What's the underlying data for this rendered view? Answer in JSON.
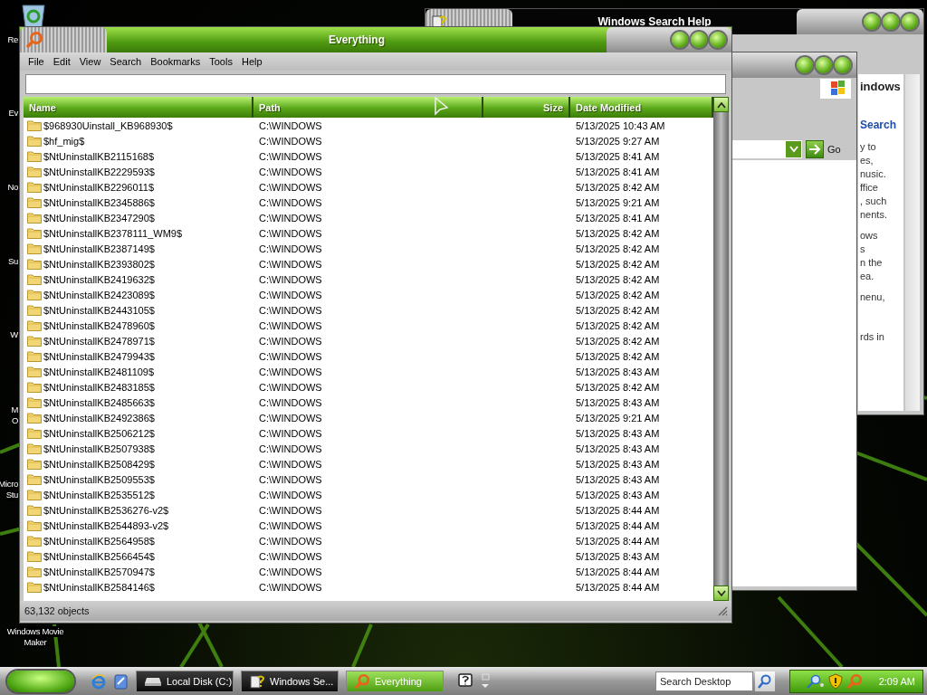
{
  "desktop_icons": [
    {
      "lines": [
        "Re"
      ]
    },
    {
      "lines": [
        "Ev"
      ]
    },
    {
      "lines": [
        "No"
      ]
    },
    {
      "lines": [
        "Su"
      ]
    },
    {
      "lines": [
        "W"
      ]
    },
    {
      "lines": [
        "M",
        "O"
      ]
    },
    {
      "lines": [
        "Micro",
        "Stu"
      ]
    },
    {
      "lines": [
        "Windows Movie",
        "Maker"
      ]
    }
  ],
  "help_window": {
    "title": "Windows Search Help",
    "heading_1": "indows",
    "heading_2": "Search",
    "paragraphs": [
      [
        "y to",
        "es,",
        "nusic.",
        "ffice",
        ", such",
        "nents."
      ],
      [
        "ows",
        "s",
        "n the",
        "ea."
      ],
      [
        "nenu,"
      ],
      [
        "rds in"
      ]
    ]
  },
  "search_window": {
    "go_label": "Go"
  },
  "everything": {
    "title": "Everything",
    "menu": [
      "File",
      "Edit",
      "View",
      "Search",
      "Bookmarks",
      "Tools",
      "Help"
    ],
    "columns": [
      {
        "label": "Name"
      },
      {
        "label": "Path"
      },
      {
        "label": "Size"
      },
      {
        "label": "Date Modified"
      }
    ],
    "rows": [
      {
        "name": "$968930Uinstall_KB968930$",
        "path": "C:\\WINDOWS",
        "modified": "5/13/2025 10:43 AM"
      },
      {
        "name": "$hf_mig$",
        "path": "C:\\WINDOWS",
        "modified": "5/13/2025 9:27 AM"
      },
      {
        "name": "$NtUninstallKB2115168$",
        "path": "C:\\WINDOWS",
        "modified": "5/13/2025 8:41 AM"
      },
      {
        "name": "$NtUninstallKB2229593$",
        "path": "C:\\WINDOWS",
        "modified": "5/13/2025 8:41 AM"
      },
      {
        "name": "$NtUninstallKB2296011$",
        "path": "C:\\WINDOWS",
        "modified": "5/13/2025 8:42 AM"
      },
      {
        "name": "$NtUninstallKB2345886$",
        "path": "C:\\WINDOWS",
        "modified": "5/13/2025 9:21 AM"
      },
      {
        "name": "$NtUninstallKB2347290$",
        "path": "C:\\WINDOWS",
        "modified": "5/13/2025 8:41 AM"
      },
      {
        "name": "$NtUninstallKB2378111_WM9$",
        "path": "C:\\WINDOWS",
        "modified": "5/13/2025 8:42 AM"
      },
      {
        "name": "$NtUninstallKB2387149$",
        "path": "C:\\WINDOWS",
        "modified": "5/13/2025 8:42 AM"
      },
      {
        "name": "$NtUninstallKB2393802$",
        "path": "C:\\WINDOWS",
        "modified": "5/13/2025 8:42 AM"
      },
      {
        "name": "$NtUninstallKB2419632$",
        "path": "C:\\WINDOWS",
        "modified": "5/13/2025 8:42 AM"
      },
      {
        "name": "$NtUninstallKB2423089$",
        "path": "C:\\WINDOWS",
        "modified": "5/13/2025 8:42 AM"
      },
      {
        "name": "$NtUninstallKB2443105$",
        "path": "C:\\WINDOWS",
        "modified": "5/13/2025 8:42 AM"
      },
      {
        "name": "$NtUninstallKB2478960$",
        "path": "C:\\WINDOWS",
        "modified": "5/13/2025 8:42 AM"
      },
      {
        "name": "$NtUninstallKB2478971$",
        "path": "C:\\WINDOWS",
        "modified": "5/13/2025 8:42 AM"
      },
      {
        "name": "$NtUninstallKB2479943$",
        "path": "C:\\WINDOWS",
        "modified": "5/13/2025 8:42 AM"
      },
      {
        "name": "$NtUninstallKB2481109$",
        "path": "C:\\WINDOWS",
        "modified": "5/13/2025 8:43 AM"
      },
      {
        "name": "$NtUninstallKB2483185$",
        "path": "C:\\WINDOWS",
        "modified": "5/13/2025 8:42 AM"
      },
      {
        "name": "$NtUninstallKB2485663$",
        "path": "C:\\WINDOWS",
        "modified": "5/13/2025 8:43 AM"
      },
      {
        "name": "$NtUninstallKB2492386$",
        "path": "C:\\WINDOWS",
        "modified": "5/13/2025 9:21 AM"
      },
      {
        "name": "$NtUninstallKB2506212$",
        "path": "C:\\WINDOWS",
        "modified": "5/13/2025 8:43 AM"
      },
      {
        "name": "$NtUninstallKB2507938$",
        "path": "C:\\WINDOWS",
        "modified": "5/13/2025 8:43 AM"
      },
      {
        "name": "$NtUninstallKB2508429$",
        "path": "C:\\WINDOWS",
        "modified": "5/13/2025 8:43 AM"
      },
      {
        "name": "$NtUninstallKB2509553$",
        "path": "C:\\WINDOWS",
        "modified": "5/13/2025 8:43 AM"
      },
      {
        "name": "$NtUninstallKB2535512$",
        "path": "C:\\WINDOWS",
        "modified": "5/13/2025 8:43 AM"
      },
      {
        "name": "$NtUninstallKB2536276-v2$",
        "path": "C:\\WINDOWS",
        "modified": "5/13/2025 8:44 AM"
      },
      {
        "name": "$NtUninstallKB2544893-v2$",
        "path": "C:\\WINDOWS",
        "modified": "5/13/2025 8:44 AM"
      },
      {
        "name": "$NtUninstallKB2564958$",
        "path": "C:\\WINDOWS",
        "modified": "5/13/2025 8:44 AM"
      },
      {
        "name": "$NtUninstallKB2566454$",
        "path": "C:\\WINDOWS",
        "modified": "5/13/2025 8:43 AM"
      },
      {
        "name": "$NtUninstallKB2570947$",
        "path": "C:\\WINDOWS",
        "modified": "5/13/2025 8:44 AM"
      },
      {
        "name": "$NtUninstallKB2584146$",
        "path": "C:\\WINDOWS",
        "modified": "5/13/2025 8:44 AM"
      }
    ],
    "status": "63,132 objects"
  },
  "taskbar": {
    "tasks": [
      {
        "label": "Local Disk (C:)",
        "kind": "drive",
        "selected": false
      },
      {
        "label": "Windows Se...",
        "kind": "help",
        "selected": false
      },
      {
        "label": "Everything",
        "kind": "search",
        "selected": true
      }
    ],
    "search": {
      "placeholder": "Search Desktop"
    },
    "clock": "2:09 AM"
  }
}
